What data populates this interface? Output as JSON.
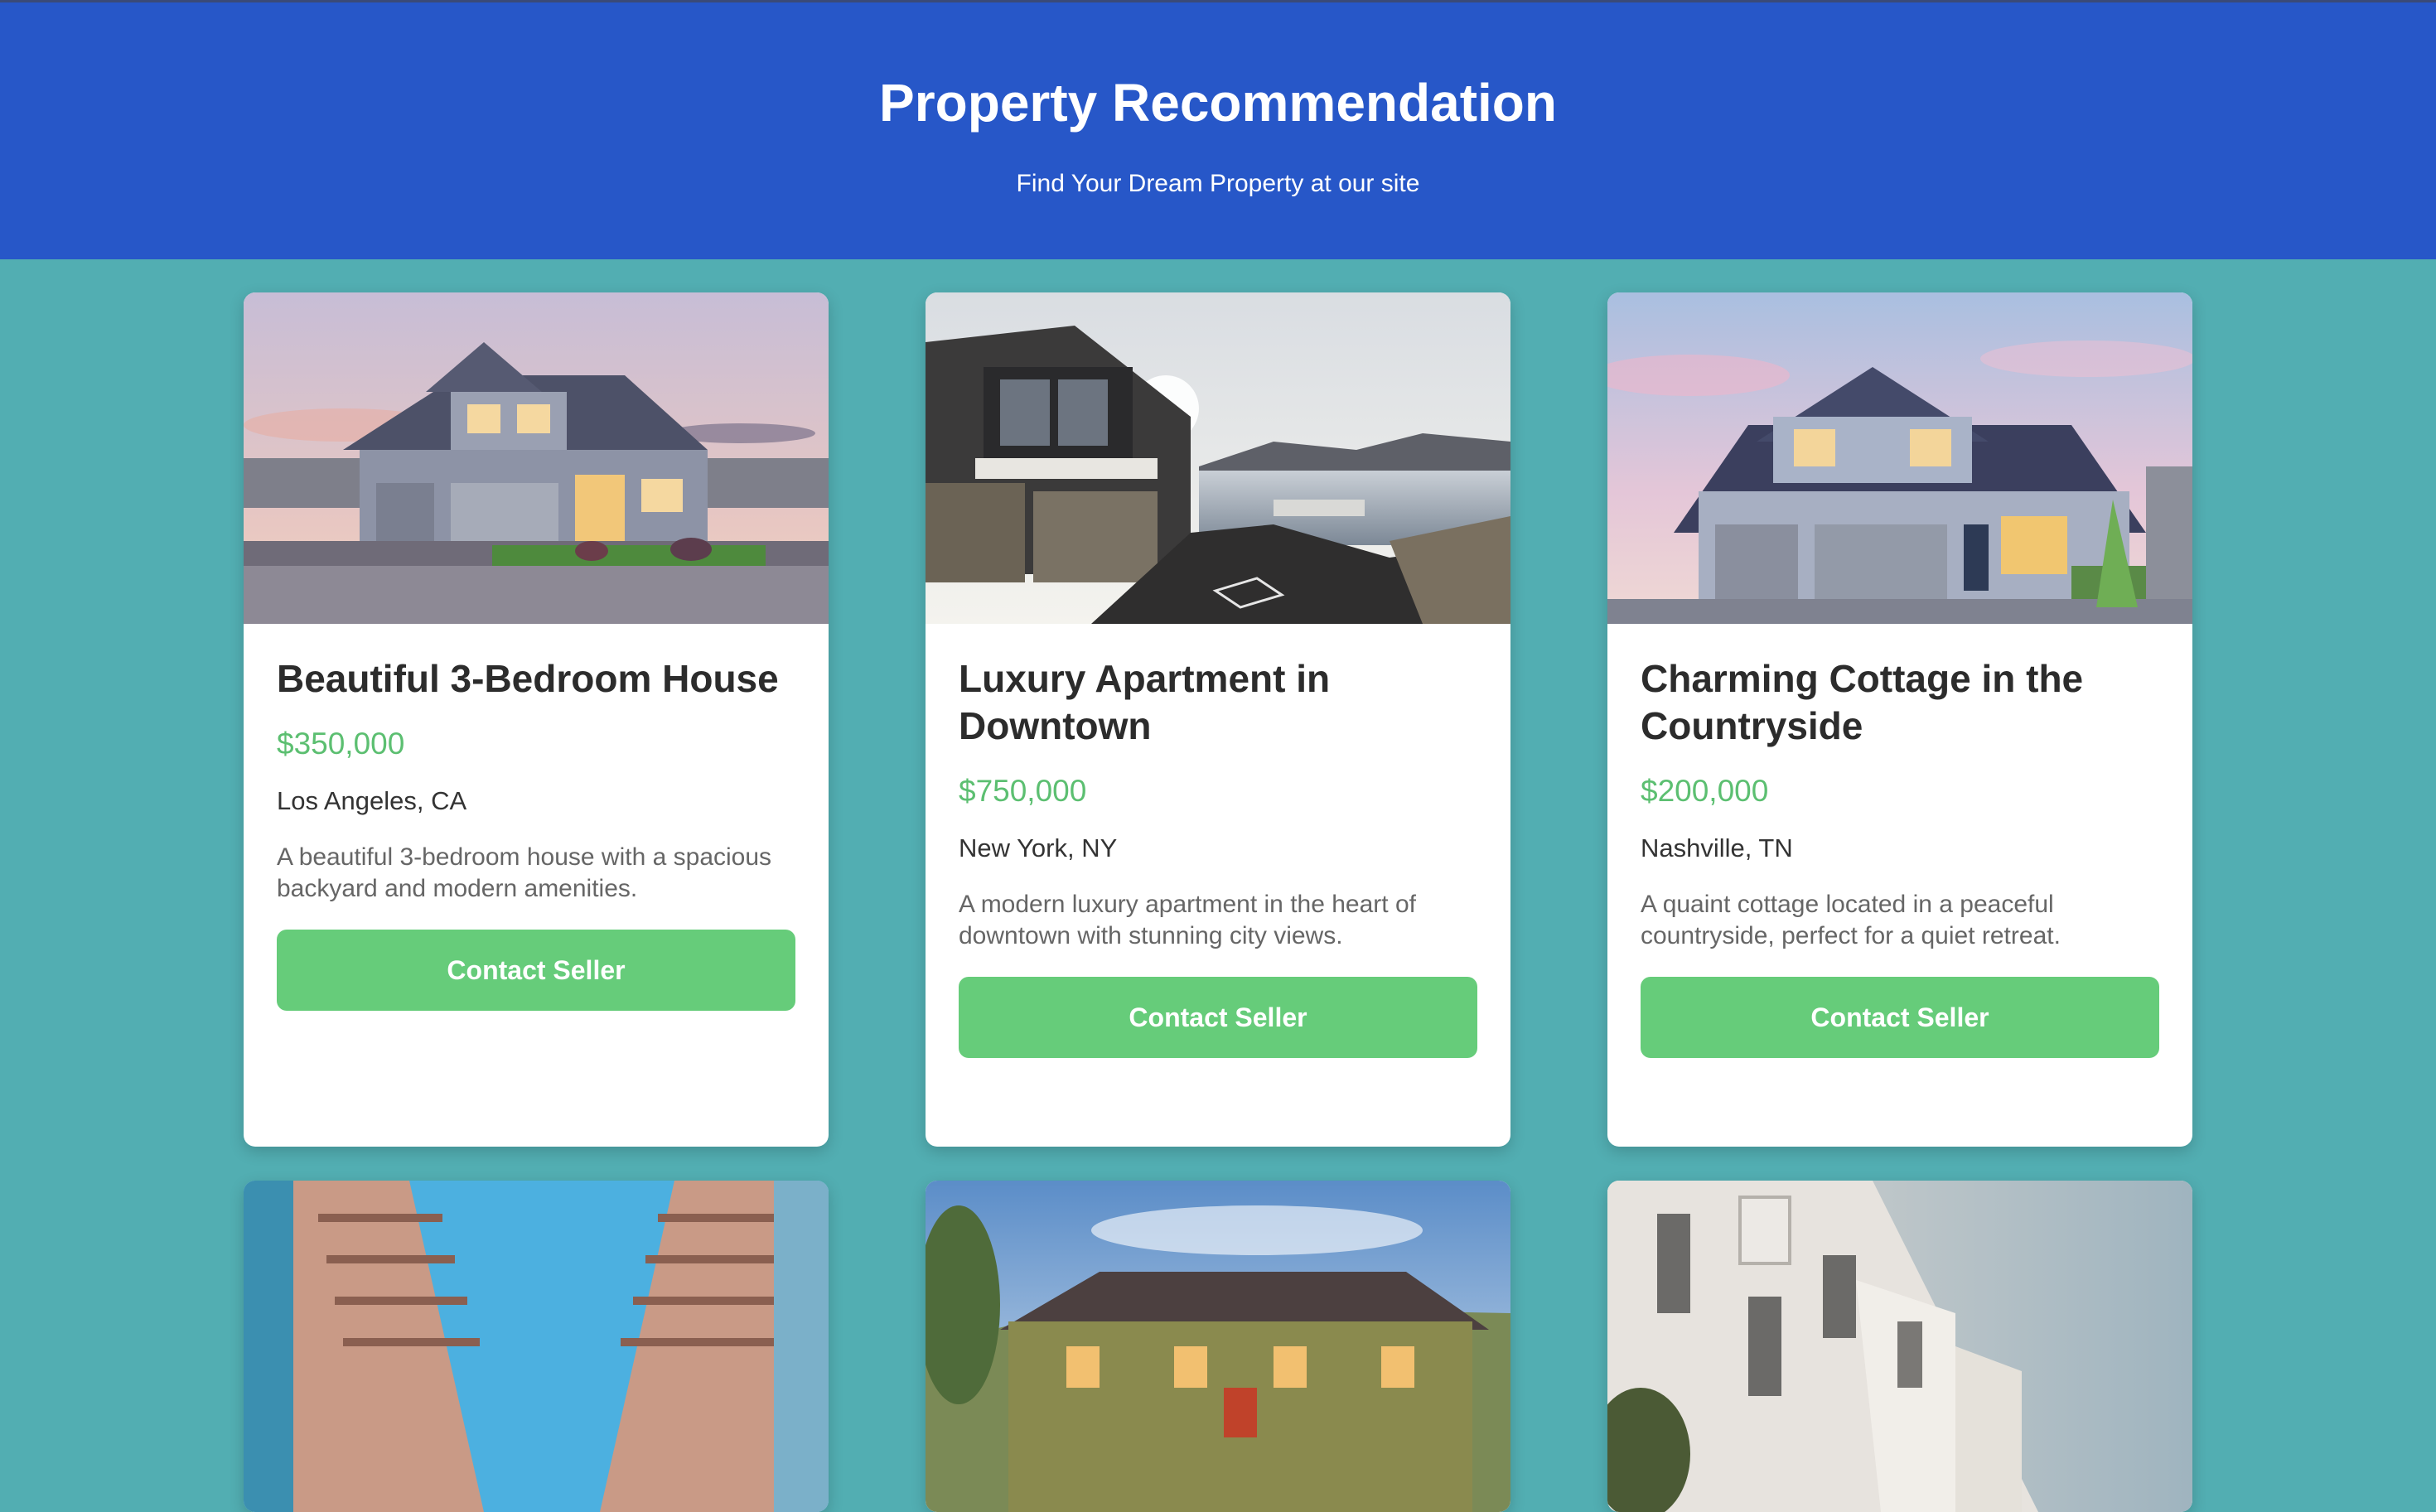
{
  "header": {
    "title": "Property Recommendation",
    "subtitle": "Find Your Dream Property at our site"
  },
  "colors": {
    "header_bg": "#2757c8",
    "page_bg": "#52aeb2",
    "price": "#5cbf71",
    "button": "#66cc7a"
  },
  "properties": [
    {
      "title": "Beautiful 3-Bedroom House",
      "price": "$350,000",
      "location": "Los Angeles, CA",
      "description": "A beautiful 3-bedroom house with a spacious backyard and modern amenities.",
      "button_label": "Contact Seller"
    },
    {
      "title": "Luxury Apartment in Downtown",
      "price": "$750,000",
      "location": "New York, NY",
      "description": "A modern luxury apartment in the heart of downtown with stunning city views.",
      "button_label": "Contact Seller"
    },
    {
      "title": "Charming Cottage in the Countryside",
      "price": "$200,000",
      "location": "Nashville, TN",
      "description": "A quaint cottage located in a peaceful countryside, perfect for a quiet retreat.",
      "button_label": "Contact Seller"
    }
  ]
}
